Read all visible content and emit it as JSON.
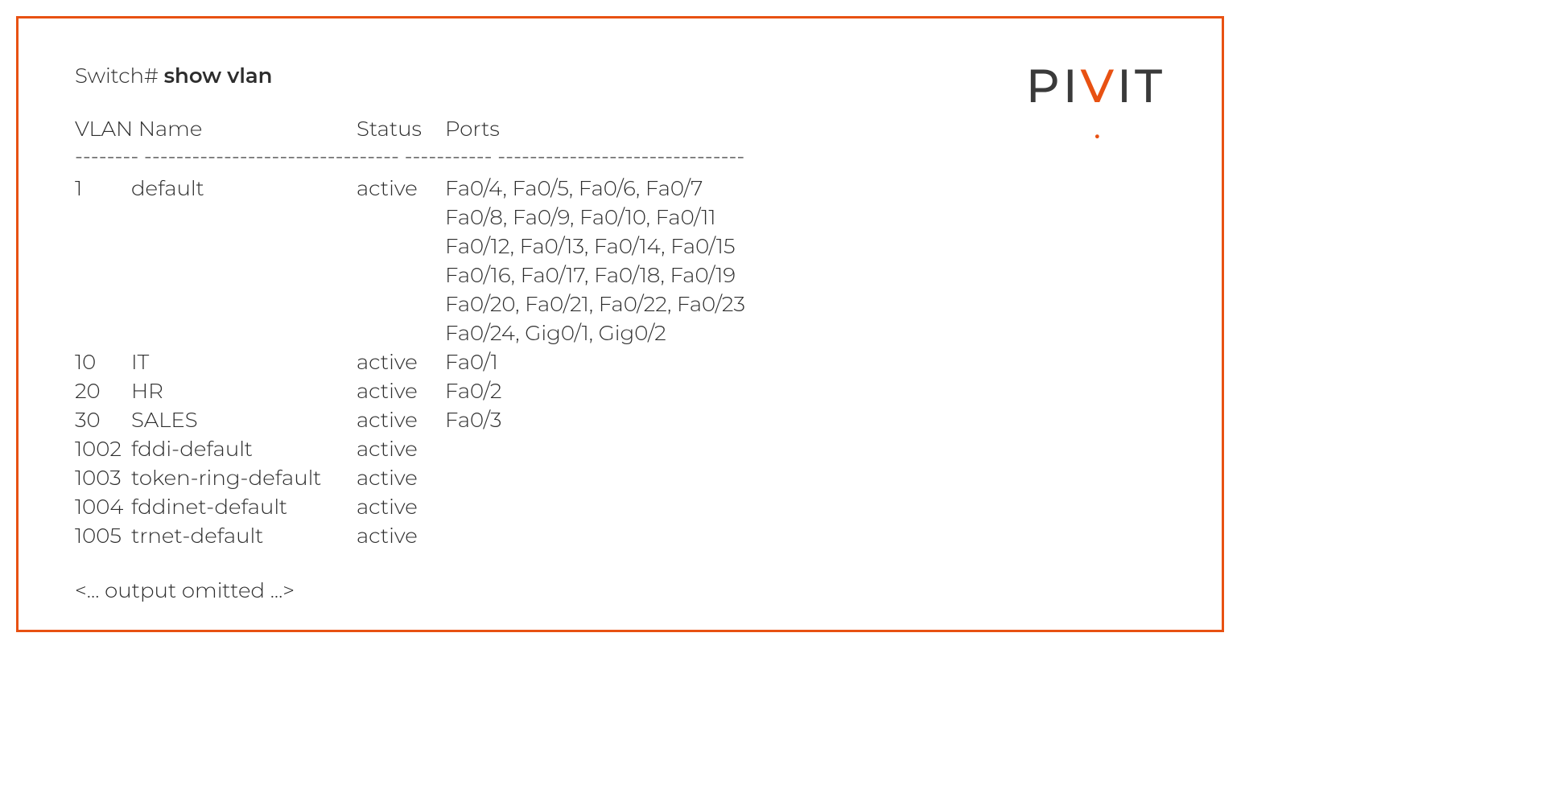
{
  "prompt": {
    "prefix": "Switch# ",
    "command": "show vlan"
  },
  "header": {
    "vlan_name": "VLAN Name",
    "status": "Status",
    "ports": "Ports"
  },
  "separator": "-------- -------------------------------- ----------- -------------------------------",
  "rows": [
    {
      "id": "1",
      "name": "default",
      "status": "active",
      "port_lines": [
        "Fa0/4, Fa0/5, Fa0/6, Fa0/7",
        "Fa0/8, Fa0/9, Fa0/10, Fa0/11",
        "Fa0/12, Fa0/13, Fa0/14, Fa0/15",
        "Fa0/16, Fa0/17, Fa0/18, Fa0/19",
        "Fa0/20, Fa0/21, Fa0/22, Fa0/23",
        "Fa0/24, Gig0/1, Gig0/2"
      ]
    },
    {
      "id": "10",
      "name": "IT",
      "status": "active",
      "port_lines": [
        "Fa0/1"
      ]
    },
    {
      "id": "20",
      "name": "HR",
      "status": "active",
      "port_lines": [
        "Fa0/2"
      ]
    },
    {
      "id": "30",
      "name": "SALES",
      "status": "active",
      "port_lines": [
        "Fa0/3"
      ]
    },
    {
      "id": "1002",
      "name": "fddi-default",
      "status": "active",
      "port_lines": [
        ""
      ]
    },
    {
      "id": "1003",
      "name": "token-ring-default",
      "status": "active",
      "port_lines": [
        ""
      ]
    },
    {
      "id": "1004",
      "name": "fddinet-default",
      "status": "active",
      "port_lines": [
        ""
      ]
    },
    {
      "id": "1005",
      "name": "trnet-default",
      "status": "active",
      "port_lines": [
        ""
      ]
    }
  ],
  "omitted": "<... output omitted ...>",
  "logo": {
    "p": "P",
    "i1": "I",
    "v": "V",
    "i2": "I",
    "t": "T",
    "dot": "•"
  }
}
